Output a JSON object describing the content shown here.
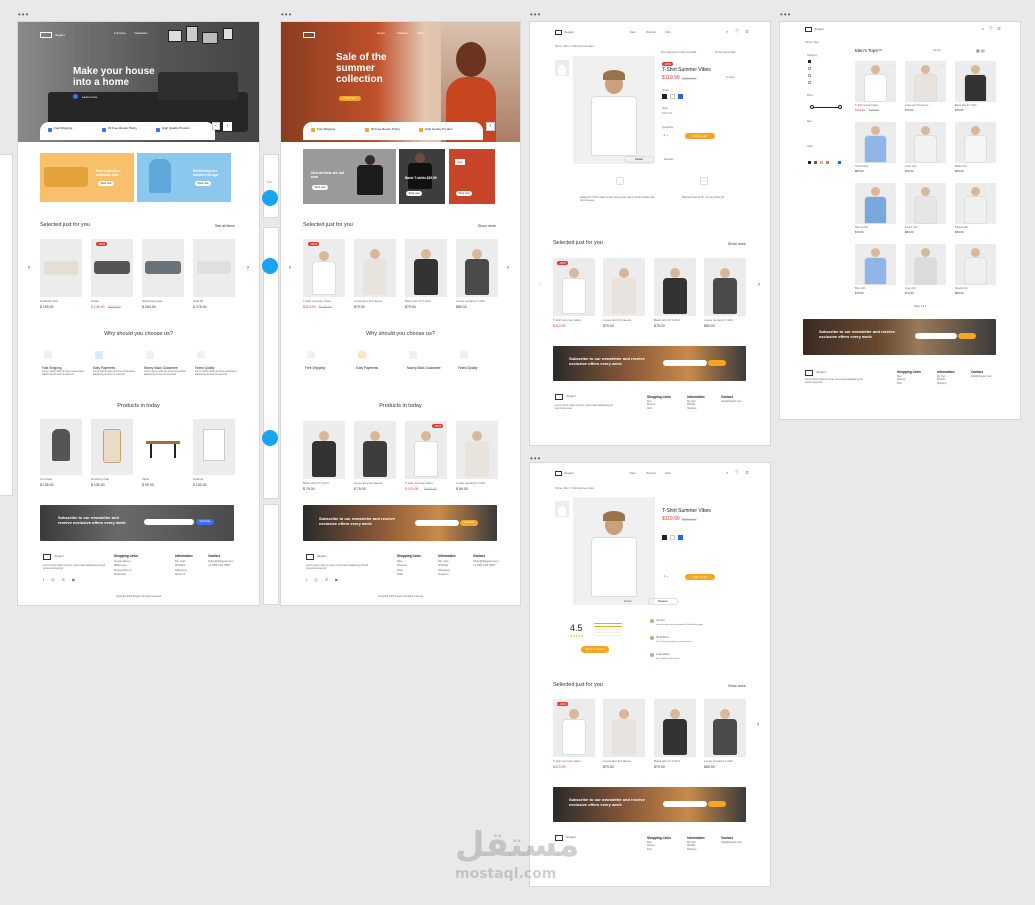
{
  "artboards": {
    "furniture": {
      "hero_title": "Make your house into a home",
      "nav": [
        "Furniture",
        "Inspiration"
      ],
      "hero_btn": "Learn more",
      "features_strip": [
        "Fast Shipping",
        "30 Free Return Policy",
        "High Quality Product"
      ],
      "promo_1": "New collection available now",
      "promo_2": "Redefining the modern design",
      "promo_btn": "Shop now",
      "selected_title": "Selected just for you",
      "see_all": "See all items",
      "selected_items": [
        {
          "name": "Hubland sofa",
          "price": "$ 199.00",
          "old": ""
        },
        {
          "name": "Sofas",
          "price": "$ 145.00",
          "old": "$230.00",
          "tag": "-30%"
        },
        {
          "name": "Sectional sofas",
          "price": "$ 264.00",
          "old": ""
        },
        {
          "name": "Sofa 5ft",
          "price": "$ 275.00",
          "old": ""
        }
      ],
      "why_title": "Why should you choose us?",
      "why_items": [
        "Fast Shipping",
        "Easy Payments",
        "Money-Back Guarantee",
        "Finest Quality"
      ],
      "why_desc": "Lorem ipsum dolor sit amet consectetur adipiscing elit sed do eiusmod",
      "trending_title": "Products in today",
      "trending_items": [
        {
          "name": "Armchair",
          "price": "$ 195.00"
        },
        {
          "name": "Rocking chair",
          "price": "$ 130.00"
        },
        {
          "name": "Table",
          "price": "$ 90.00"
        },
        {
          "name": "Cabinet",
          "price": "$ 150.00"
        }
      ],
      "newsletter": "Subscribe to our newsletter and receive exclusive offers every week",
      "newsletter_btn": "Subscribe",
      "logo": "3legant",
      "footer_cols": [
        "Shopping Links",
        "Information",
        "Contact"
      ],
      "copyright": "Copyright 2023 3legant. All rights reserved"
    },
    "fashion": {
      "hero_title": "Sale of the summer collection",
      "nav": [
        "Home",
        "Fashion",
        "Shop"
      ],
      "hero_btn": "Shop now",
      "features_strip": [
        "Fast Shipping",
        "30 Free Return Policy",
        "High Quality Product"
      ],
      "promo_1": "New arrivals are out now",
      "promo_2": "Basic T-shirts $29,99",
      "promo_3": "Sale",
      "promo_btn": "Shop now",
      "selected_title": "Selected just for you",
      "see_all": "Show more",
      "selected_items": [
        {
          "name": "T-shirt summer vibes",
          "price": "$119.99",
          "old": "$165.00",
          "tag": "-30%"
        },
        {
          "name": "Loose knit 3/4 sleeve",
          "price": "$79.00",
          "old": ""
        },
        {
          "name": "Basic slim fit T-shirt",
          "price": "$79.00",
          "old": ""
        },
        {
          "name": "Loose textured T-shirt",
          "price": "$89.00",
          "old": ""
        }
      ],
      "why_title": "Why should you choose us?",
      "why_items": [
        "Free Shipping",
        "Easy Payments",
        "Money-Back Guarantee",
        "Finest Quality"
      ],
      "trending_title": "Products in today",
      "trending_items": [
        {
          "name": "Basic slim fit T-shirt",
          "price": "$ 79.00"
        },
        {
          "name": "Loose knit 3/4 sleeve",
          "price": "$ 79.00"
        },
        {
          "name": "T-shirt summer vibes",
          "price": "$ 119.99",
          "old": "$165.00",
          "tag": "-30%"
        },
        {
          "name": "Loose textured T-shirt",
          "price": "$ 89.00"
        }
      ],
      "newsletter": "Subscribe to our newsletter and receive exclusive offers every week",
      "newsletter_btn": "Subscribe",
      "logo": "3legant",
      "footer_cols": [
        "Shopping Links",
        "Information",
        "Contact"
      ],
      "copyright": "Copyright 2023 3legant. All rights reserved"
    },
    "product": {
      "logo": "3legant",
      "nav": [
        "Men",
        "Women",
        "Kids"
      ],
      "breadcrumb": "Home / Men / T-shirt summer vibes",
      "title": "T-Shirt Summer Vibes",
      "price": "$119.99",
      "old_price": "$165.00",
      "tag": "-30%",
      "color_label": "Color",
      "size_label": "Size",
      "qty_label": "Quantity",
      "add_btn": "Add to cart",
      "tab_1": "Details",
      "tab_2": "Reviews",
      "selected_title": "Selected just for you",
      "see_all": "Show more",
      "items": [
        {
          "name": "T-shirt summer vibes",
          "price": "$119.99",
          "old": "$165.00",
          "tag": "-30%"
        },
        {
          "name": "Loose knit 3/4 sleeve",
          "price": "$79.00"
        },
        {
          "name": "Basic slim fit T-shirt",
          "price": "$79.00"
        },
        {
          "name": "Loose textured T-shirt",
          "price": "$89.00"
        }
      ],
      "newsletter": "Subscribe to our newsletter and receive exclusive offers every week"
    },
    "product_reviews": {
      "title": "T-Shirt Summer Vibes",
      "price": "$119.99",
      "old_price": "$165.00",
      "rating": "4.5",
      "tab_1": "Details",
      "tab_2": "Reviews",
      "review_btn": "Write a review",
      "reviewers": [
        "Jennifer",
        "Stella Brent",
        "Linda Marks"
      ],
      "selected_title": "Selected just for you",
      "see_all": "Show more",
      "items": [
        {
          "name": "T-shirt summer vibes",
          "price": "$119.99",
          "old": "$165.00",
          "tag": "-30%"
        },
        {
          "name": "Loose knit 3/4 sleeve",
          "price": "$79.00"
        },
        {
          "name": "Basic slim fit T-shirt",
          "price": "$79.00"
        },
        {
          "name": "Loose textured T-shirt",
          "price": "$89.00"
        }
      ],
      "newsletter": "Subscribe to our newsletter and receive exclusive offers every week"
    },
    "listing": {
      "logo": "3legant",
      "heading": "Men's Tops",
      "count": "(98)",
      "filters": [
        "Category",
        "Price",
        "Size",
        "Color"
      ],
      "sort": "Sort by",
      "items": [
        {
          "name": "T-shirt summer vibes",
          "price": "$119.99",
          "old": "$165.00"
        },
        {
          "name": "Loose knit 3/4 sleeve",
          "price": "$79.00"
        },
        {
          "name": "Basic slim fit T-shirt",
          "price": "$79.00"
        },
        {
          "name": "Oxford shirt",
          "price": "$89.00"
        },
        {
          "name": "Linen shirt",
          "price": "$79.00"
        },
        {
          "name": "White shirt",
          "price": "$69.00"
        },
        {
          "name": "Slim fit shirt",
          "price": "$79.00"
        },
        {
          "name": "Denim shirt",
          "price": "$89.00"
        },
        {
          "name": "Casual shirt",
          "price": "$69.00"
        },
        {
          "name": "Blue shirt",
          "price": "$79.00"
        },
        {
          "name": "Gray shirt",
          "price": "$79.00"
        },
        {
          "name": "Check shirt",
          "price": "$89.00"
        }
      ],
      "newsletter": "Subscribe to our newsletter and receive exclusive offers every week"
    }
  },
  "watermark": {
    "arabic": "مستقل",
    "latin": "mostaql.com"
  },
  "colors": {
    "accent": "#f5a623",
    "sale": "#e53935",
    "connector": "#1aa3f0",
    "canvas": "#e9e9e9"
  }
}
